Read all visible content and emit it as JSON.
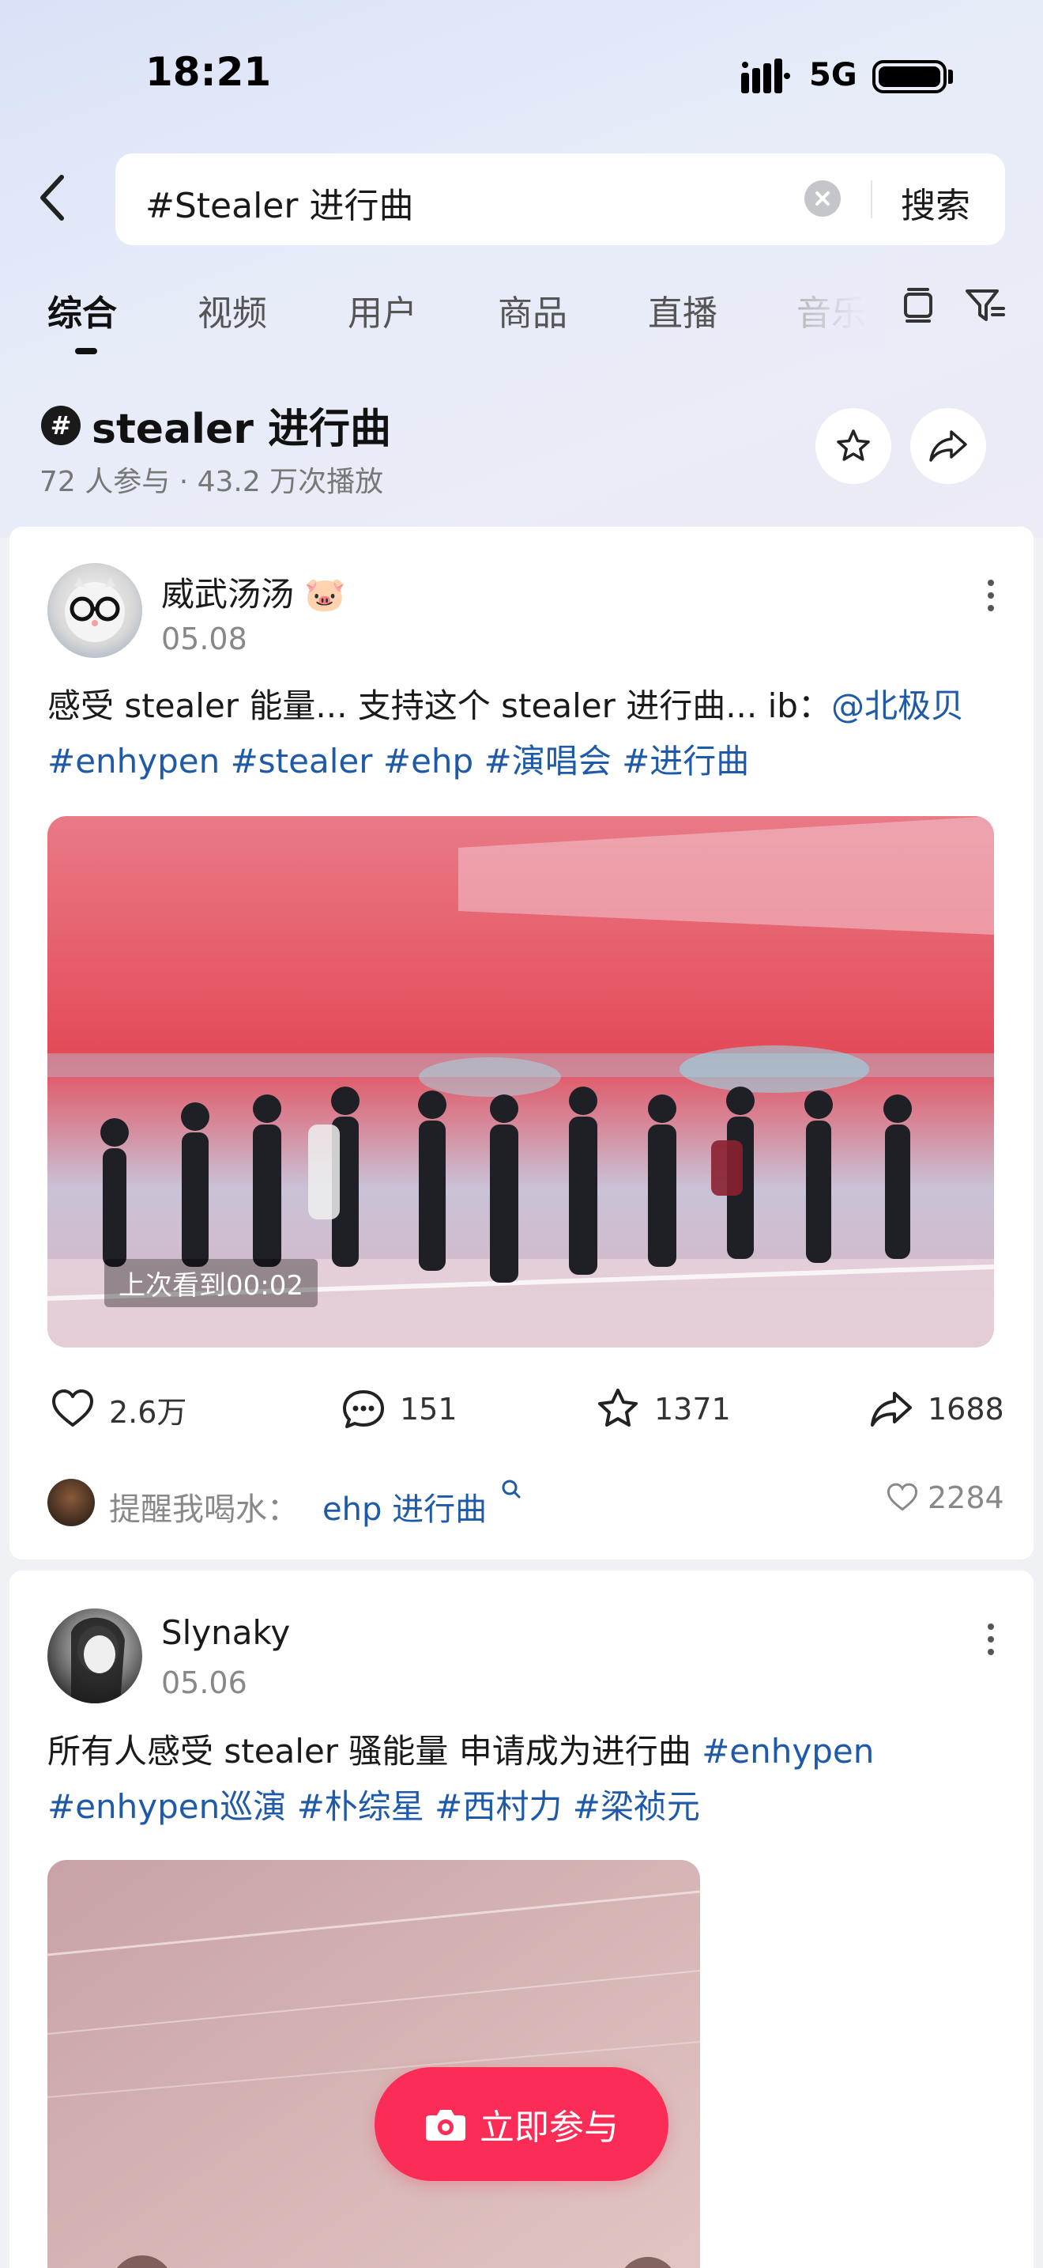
{
  "status_bar": {
    "time": "18:21",
    "network": "5G"
  },
  "search": {
    "query": "#Stealer 进行曲",
    "submit_label": "搜索"
  },
  "tabs": [
    "综合",
    "视频",
    "用户",
    "商品",
    "直播",
    "音乐"
  ],
  "topic": {
    "name": "stealer 进行曲",
    "stats": "72 人参与 · 43.2 万次播放",
    "hash_symbol": "#"
  },
  "posts": [
    {
      "author": "威武汤汤",
      "author_emoji": "🐷",
      "date": "05.08",
      "text_plain": "感受 stealer 能量... 支持这个 stealer 进行曲... ib：",
      "mention": "@北极贝",
      "tags": [
        "#enhypen",
        "#stealer",
        "#ehp",
        "#演唱会",
        "#进行曲"
      ],
      "resume_text": "上次看到00:02",
      "likes": "2.6万",
      "comments": "151",
      "favorites": "1371",
      "shares": "1688",
      "top_comment": {
        "user": "提醒我喝水：",
        "text": "ehp 进行曲",
        "likes": "2284"
      }
    },
    {
      "author": "Slynaky",
      "date": "05.06",
      "text_plain": "所有人感受 stealer 骚能量 申请成为进行曲 ",
      "tags": [
        "#enhypen",
        "#enhypen巡演",
        "#朴综星",
        "#西村力",
        "#梁祯元"
      ]
    }
  ],
  "cta": {
    "label": "立即参与"
  },
  "colors": {
    "accent": "#fb2c55",
    "link": "#1e5aa8",
    "background": "#f0f1f5"
  }
}
